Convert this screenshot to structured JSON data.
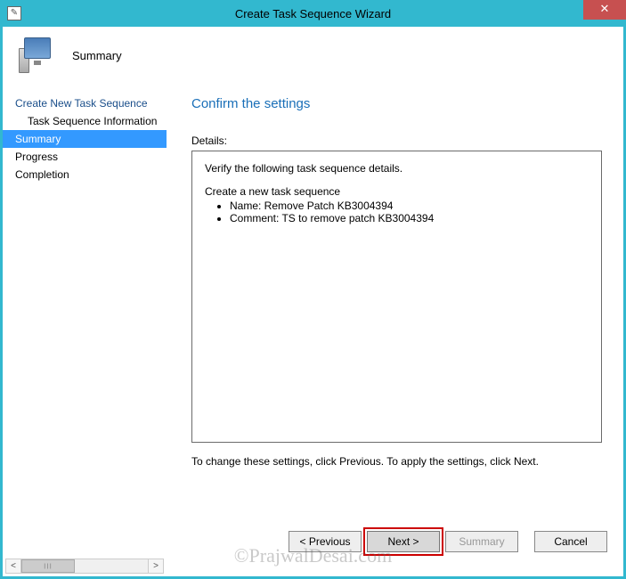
{
  "window": {
    "title": "Create Task Sequence Wizard"
  },
  "header": {
    "title": "Summary"
  },
  "sidebar": {
    "items": [
      {
        "label": "Create New Task Sequence",
        "selected": false,
        "sub": false
      },
      {
        "label": "Task Sequence Information",
        "selected": false,
        "sub": true
      },
      {
        "label": "Summary",
        "selected": true,
        "sub": false
      },
      {
        "label": "Progress",
        "selected": false,
        "sub": false
      },
      {
        "label": "Completion",
        "selected": false,
        "sub": false
      }
    ]
  },
  "content": {
    "heading": "Confirm the settings",
    "details_label": "Details:",
    "details": {
      "intro": "Verify the following task sequence details.",
      "group_title": "Create a new task sequence",
      "lines": [
        "Name: Remove Patch KB3004394",
        "Comment: TS to remove patch KB3004394"
      ]
    },
    "hint": "To change these settings, click Previous. To apply the settings, click Next."
  },
  "footer": {
    "previous": "< Previous",
    "next": "Next >",
    "summary": "Summary",
    "cancel": "Cancel"
  },
  "watermark": "©PrajwalDesai.com"
}
